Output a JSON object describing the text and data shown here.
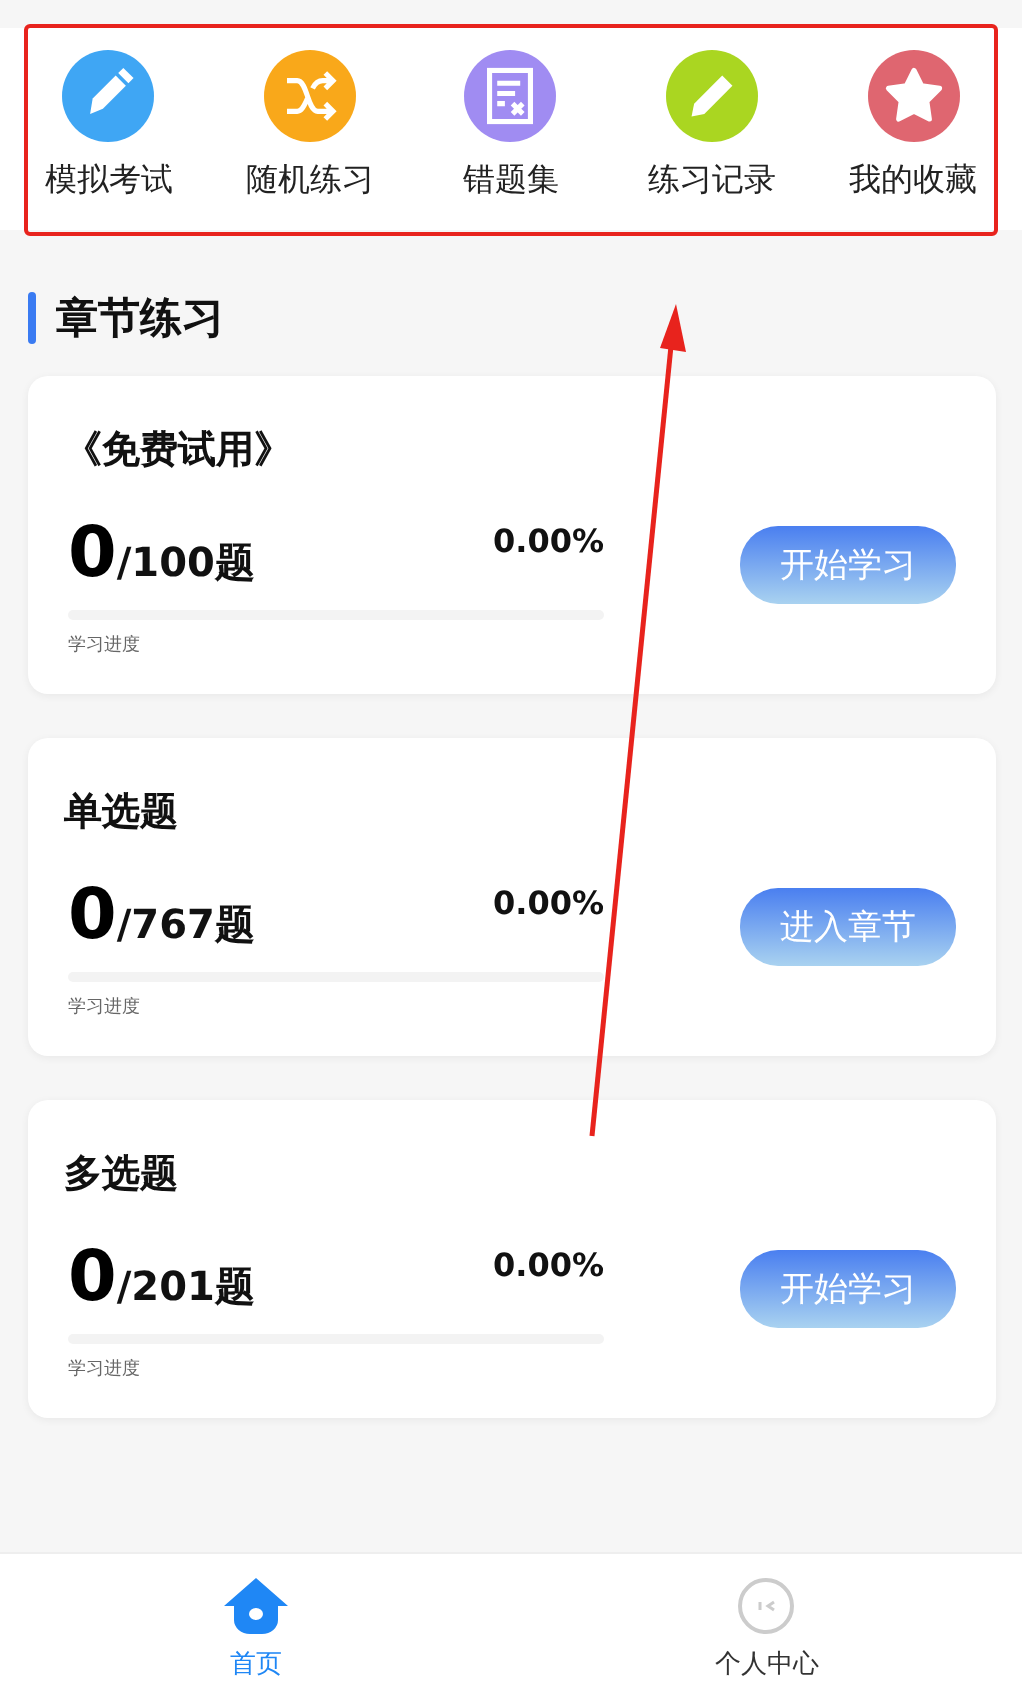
{
  "shortcuts": [
    {
      "kind": "pencil",
      "color": "#3fa6f4",
      "label": "模拟考试"
    },
    {
      "kind": "shuffle",
      "color": "#f9a81a",
      "label": "随机练习"
    },
    {
      "kind": "wrong-list",
      "color": "#a08cf2",
      "label": "错题集"
    },
    {
      "kind": "edit",
      "color": "#aad621",
      "label": "练习记录"
    },
    {
      "kind": "star",
      "color": "#df6670",
      "label": "我的收藏"
    }
  ],
  "section_title": "章节练习",
  "chapters": [
    {
      "title": "《免费试用》",
      "done": "0",
      "total": "/100题",
      "percent": "0.00%",
      "level": 0,
      "progress_label": "学习进度",
      "button": "开始学习"
    },
    {
      "title": "单选题",
      "done": "0",
      "total": "/767题",
      "percent": "0.00%",
      "level": 0,
      "progress_label": "学习进度",
      "button": "进入章节"
    },
    {
      "title": "多选题",
      "done": "0",
      "total": "/201题",
      "percent": "0.00%",
      "level": 0,
      "progress_label": "学习进度",
      "button": "开始学习"
    }
  ],
  "tabs": [
    {
      "kind": "home",
      "label": "首页",
      "selected": true
    },
    {
      "kind": "profile",
      "label": "个人中心",
      "selected": false
    }
  ]
}
